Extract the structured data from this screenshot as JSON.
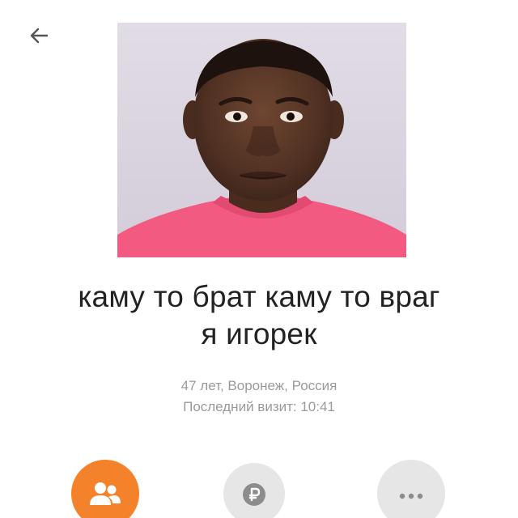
{
  "header": {
    "back_icon": "arrow-left-icon"
  },
  "profile": {
    "photo_alt": "",
    "name_line1": "каму то брат каму то враг",
    "name_line2": "я игорек",
    "details": "47 лет, Воронеж, Россия",
    "last_visit": "Последний визит: 10:41"
  },
  "actions": [
    {
      "icon": "friends-icon",
      "color": "#f3822b"
    },
    {
      "icon": "ruble-icon",
      "color": "#e6e6e6"
    },
    {
      "icon": "more-dots-icon",
      "color": "#e6e6e6"
    }
  ],
  "colors": {
    "accent": "#f3822b",
    "text_primary": "#222222",
    "text_secondary": "#9a9a9a"
  }
}
